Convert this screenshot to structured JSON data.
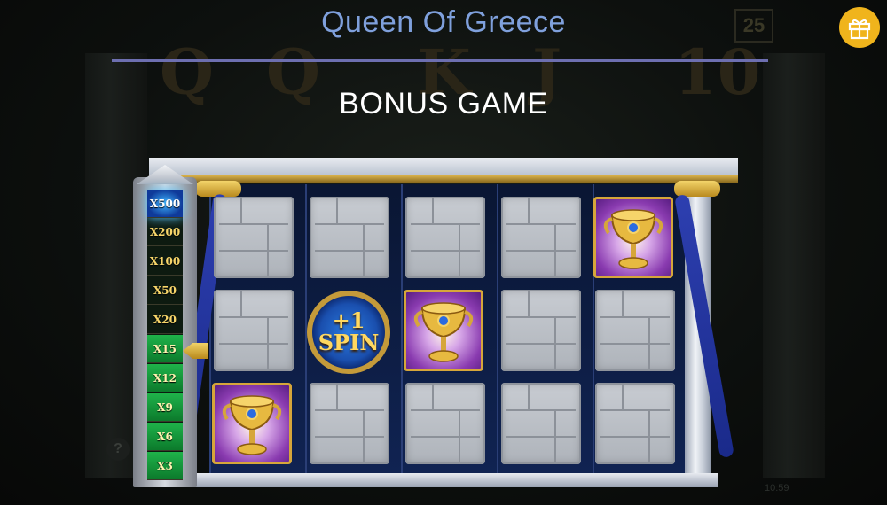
{
  "header": {
    "title": "Queen Of Greece",
    "gift_icon": "gift-icon"
  },
  "background_game": {
    "letters": [
      "Q",
      "Q",
      "K",
      "J",
      "10"
    ],
    "badge": "25",
    "clock": "10:59"
  },
  "bonus": {
    "title": "BONUS GAME"
  },
  "multiplier_ladder": {
    "levels": [
      "X500",
      "X200",
      "X100",
      "X50",
      "X20",
      "X15",
      "X12",
      "X9",
      "X6",
      "X3"
    ],
    "current": "X15"
  },
  "grid": {
    "columns": 5,
    "rows": 3,
    "cells": [
      [
        "stone",
        "stone",
        "stone",
        "stone",
        "chalice"
      ],
      [
        "stone",
        "spin",
        "chalice",
        "stone",
        "stone"
      ],
      [
        "chalice",
        "stone",
        "stone",
        "stone",
        "stone"
      ]
    ],
    "spin_label_top": "+1",
    "spin_label_bottom": "SPIN"
  },
  "colors": {
    "title": "#7fa0dc",
    "gold": "#d6a63a",
    "ladder_green": "#1fb34a",
    "reel_blue": "#102352"
  }
}
